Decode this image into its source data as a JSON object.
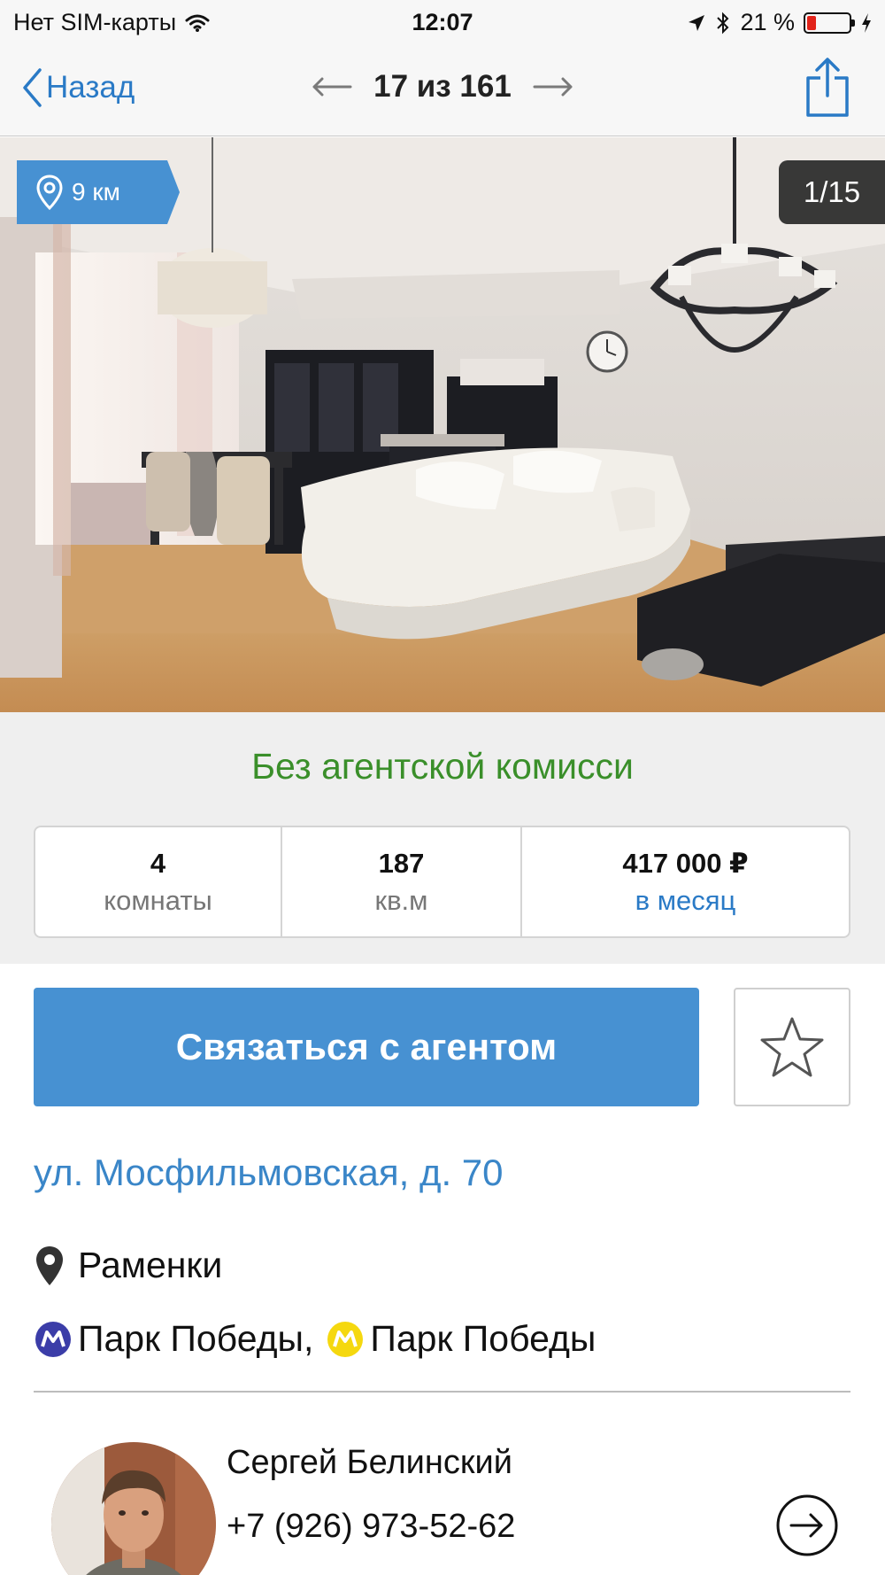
{
  "status_bar": {
    "carrier": "Нет SIM-карты",
    "time": "12:07",
    "battery_percent": "21 %",
    "battery_level": 0.21
  },
  "nav": {
    "back_label": "Назад",
    "pager": "17 из 161"
  },
  "photo": {
    "distance": "9 км",
    "counter": "1/15"
  },
  "listing": {
    "commission": "Без агентской комисси",
    "rooms_value": "4",
    "rooms_label": "комнаты",
    "area_value": "187",
    "area_label": "кв.м",
    "price_value": "417 000 ₽",
    "price_label": "в месяц"
  },
  "actions": {
    "contact_label": "Связаться с агентом"
  },
  "location": {
    "address": "ул. Мосфильмовская, д. 70",
    "district": "Раменки",
    "metro_1": "Парк Победы,",
    "metro_2": "Парк Победы",
    "metro_1_color": "#3b3da8",
    "metro_2_color": "#f5d80f"
  },
  "agent": {
    "name": "Сергей Белинский",
    "phone": "+7 (926) 973-52-62"
  },
  "colors": {
    "accent": "#4791d2",
    "link": "#2a7ac6",
    "commission_green": "#3a8f2a"
  }
}
